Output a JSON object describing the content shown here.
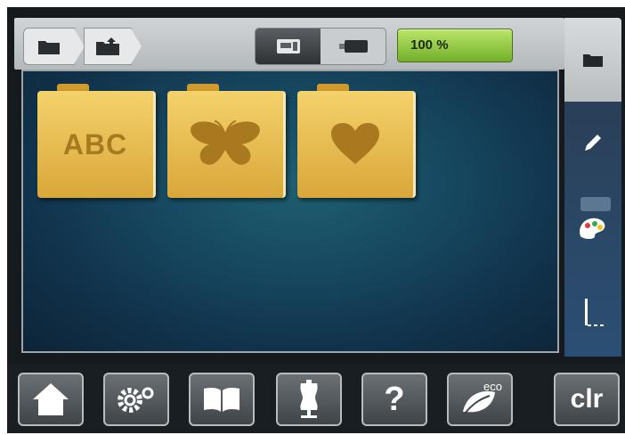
{
  "top_bar": {
    "breadcrumb": [
      {
        "icon": "folder-icon"
      },
      {
        "icon": "folder-upload-icon"
      }
    ],
    "view_toggle": [
      {
        "icon": "embroidery-machine-icon",
        "active": true
      },
      {
        "icon": "usb-stick-icon",
        "active": false
      }
    ],
    "progress": {
      "label": "100 %",
      "value_percent": 100,
      "color": "#86c232"
    }
  },
  "folders": [
    {
      "label": "ABC"
    },
    {
      "icon": "butterfly-icon"
    },
    {
      "icon": "heart-icon"
    }
  ],
  "sidebar": [
    {
      "icon": "folder-icon",
      "active": true
    },
    {
      "icon": "pencil-icon"
    },
    {
      "icon": "color-palette-icon"
    },
    {
      "icon": "needle-stitch-icon"
    }
  ],
  "bottom_bar": [
    {
      "icon": "home-icon"
    },
    {
      "icon": "settings-gears-icon"
    },
    {
      "icon": "book-icon"
    },
    {
      "icon": "dress-form-icon"
    },
    {
      "label": "?",
      "icon": "help-icon"
    },
    {
      "badge": "eco",
      "icon": "eco-leaf-icon"
    },
    {
      "label": "clr"
    }
  ],
  "colors": {
    "folder": "#e8bc4a",
    "accent_green": "#86c232",
    "background": "#174a62"
  }
}
